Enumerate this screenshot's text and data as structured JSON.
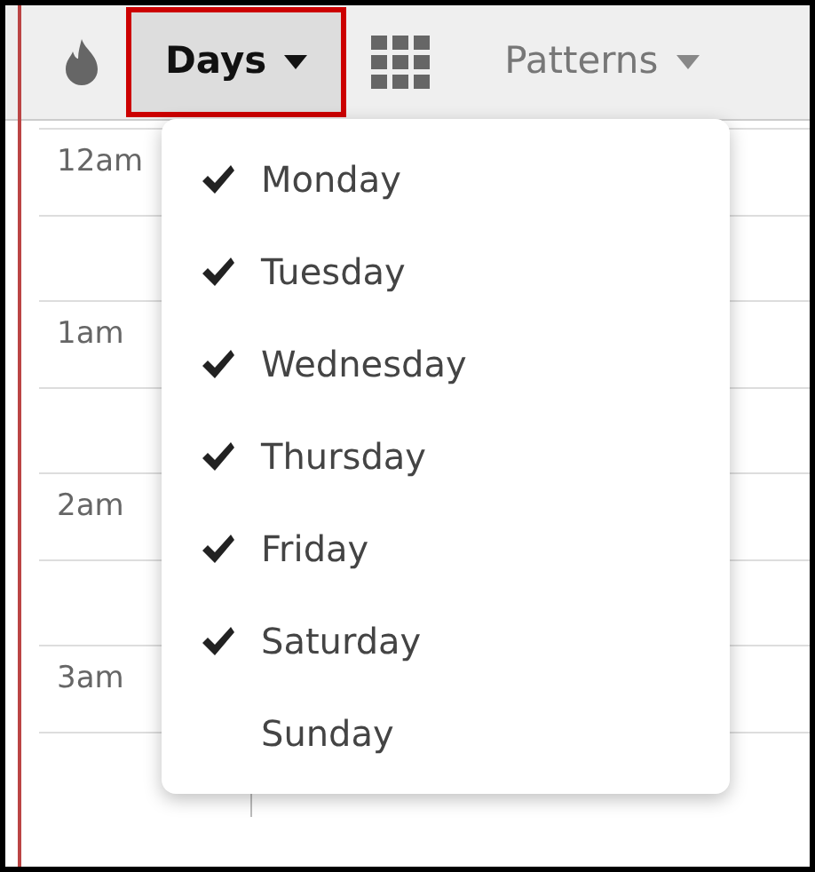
{
  "toolbar": {
    "days_button": {
      "label": "Days",
      "expanded": true
    },
    "patterns_button": {
      "label": "Patterns"
    }
  },
  "hours": [
    "12am",
    "1am",
    "2am",
    "3am"
  ],
  "days_menu": [
    {
      "label": "Monday",
      "checked": true
    },
    {
      "label": "Tuesday",
      "checked": true
    },
    {
      "label": "Wednesday",
      "checked": true
    },
    {
      "label": "Thursday",
      "checked": true
    },
    {
      "label": "Friday",
      "checked": true
    },
    {
      "label": "Saturday",
      "checked": true
    },
    {
      "label": "Sunday",
      "checked": false
    }
  ]
}
